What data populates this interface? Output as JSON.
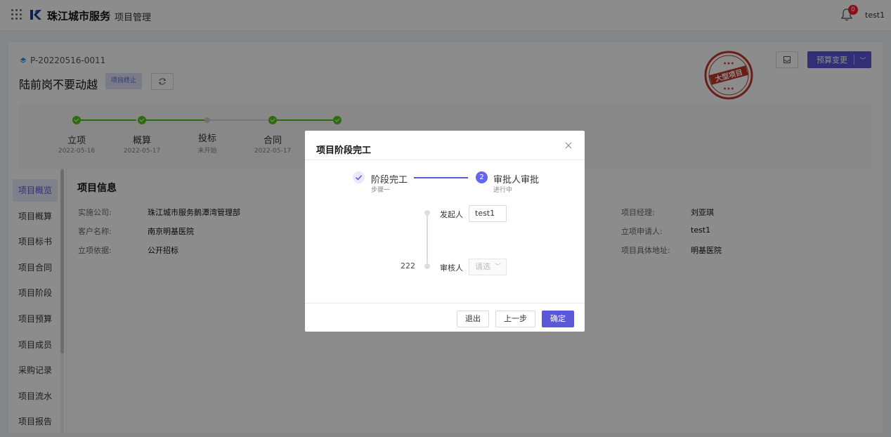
{
  "header": {
    "brand": "珠江城市服务",
    "module": "项目管理",
    "notifications": "0",
    "user": "test1"
  },
  "project": {
    "code": "P-20220516-0011",
    "title": "陆前岗不要动越",
    "status_tag": "项目终止",
    "stamp_text": "大型项目",
    "budget_change_label": "预算变更"
  },
  "stages": [
    {
      "label": "立项",
      "date": "2022-05-16"
    },
    {
      "label": "概算",
      "date": "2022-05-17"
    },
    {
      "label": "投标",
      "date": "未开始"
    },
    {
      "label": "合同",
      "date": "2022-05-17"
    }
  ],
  "sidebar": {
    "items": [
      {
        "label": "项目概览"
      },
      {
        "label": "项目概算"
      },
      {
        "label": "项目标书"
      },
      {
        "label": "项目合同"
      },
      {
        "label": "项目阶段"
      },
      {
        "label": "项目预算"
      },
      {
        "label": "项目成员"
      },
      {
        "label": "采购记录"
      },
      {
        "label": "项目流水"
      },
      {
        "label": "项目报告"
      }
    ]
  },
  "info": {
    "title": "项目信息",
    "left": [
      {
        "label": "实施公司:",
        "value": "珠江城市服务鹅潭湾管理部"
      },
      {
        "label": "客户名称:",
        "value": "南京明基医院"
      },
      {
        "label": "立项依据:",
        "value": "公开招标"
      }
    ],
    "right": [
      {
        "label": "项目经理:",
        "value": "刘亚琪"
      },
      {
        "label": "立项申请人:",
        "value": "test1"
      },
      {
        "label": "项目具体地址:",
        "value": "明基医院"
      }
    ]
  },
  "modal": {
    "title": "项目阶段完工",
    "step1_title": "阶段完工",
    "step1_desc": "步骤一",
    "step2_number": "2",
    "step2_title": "审批人审批",
    "step2_desc": "进行中",
    "initiator_label": "发起人",
    "initiator_value": "test1",
    "left_note": "222",
    "reviewer_label": "审核人",
    "reviewer_placeholder": "请选",
    "exit_label": "退出",
    "prev_label": "上一步",
    "confirm_label": "确定"
  },
  "colors": {
    "primary": "#5b57d9",
    "success": "#52c41a",
    "danger": "#f5222d",
    "stamp": "#c0392b"
  }
}
